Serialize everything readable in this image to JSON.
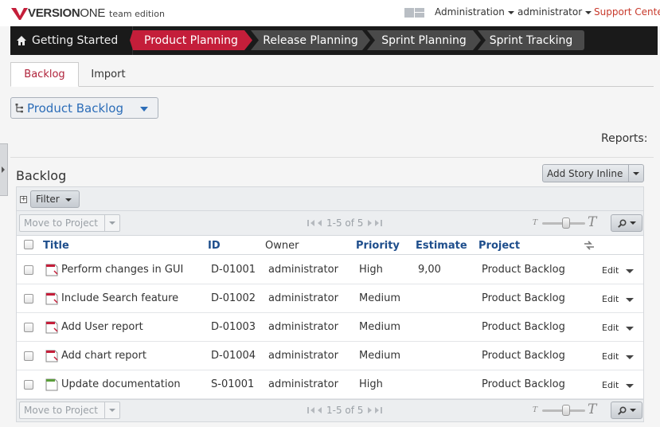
{
  "brand": {
    "name_bold": "VERSION",
    "name_rest": "ONE",
    "edition": "team edition"
  },
  "topnav": {
    "admin_menu": "Administration",
    "user_menu": "administrator",
    "support": "Support Center"
  },
  "nav": {
    "home": "Getting Started",
    "tabs": [
      {
        "label": "Product Planning",
        "active": true
      },
      {
        "label": "Release Planning",
        "active": false
      },
      {
        "label": "Sprint Planning",
        "active": false
      },
      {
        "label": "Sprint Tracking",
        "active": false
      }
    ]
  },
  "subtabs": [
    {
      "label": "Backlog",
      "active": true
    },
    {
      "label": "Import",
      "active": false
    }
  ],
  "selector": {
    "label": "Product Backlog"
  },
  "reports": {
    "label": "Reports:"
  },
  "section": {
    "title": "Backlog",
    "add_story": "Add Story Inline"
  },
  "filter": {
    "label": "Filter"
  },
  "toolbar": {
    "move_label": "Move to Project",
    "pager_text": "1-5 of 5",
    "slider_small": "T",
    "slider_big": "T",
    "slider_level": 0.55
  },
  "grid": {
    "columns": {
      "title": "Title",
      "id": "ID",
      "owner": "Owner",
      "priority": "Priority",
      "estimate": "Estimate",
      "project": "Project"
    },
    "rows": [
      {
        "title": "Perform changes in GUI",
        "id": "D-01001",
        "owner": "administrator",
        "priority": "High",
        "estimate": "9,00",
        "project": "Product Backlog",
        "action": "Edit",
        "type": "defect"
      },
      {
        "title": "Include Search feature",
        "id": "D-01002",
        "owner": "administrator",
        "priority": "Medium",
        "estimate": "",
        "project": "Product Backlog",
        "action": "Edit",
        "type": "defect"
      },
      {
        "title": "Add User report",
        "id": "D-01003",
        "owner": "administrator",
        "priority": "Medium",
        "estimate": "",
        "project": "Product Backlog",
        "action": "Edit",
        "type": "defect"
      },
      {
        "title": "Add chart report",
        "id": "D-01004",
        "owner": "administrator",
        "priority": "Medium",
        "estimate": "",
        "project": "Product Backlog",
        "action": "Edit",
        "type": "defect"
      },
      {
        "title": "Update documentation",
        "id": "S-01001",
        "owner": "administrator",
        "priority": "High",
        "estimate": "",
        "project": "Product Backlog",
        "action": "Edit",
        "type": "story"
      }
    ]
  },
  "colors": {
    "brand_red": "#c41e3a",
    "link_blue": "#2c6db8",
    "support_red": "#c8392b"
  }
}
